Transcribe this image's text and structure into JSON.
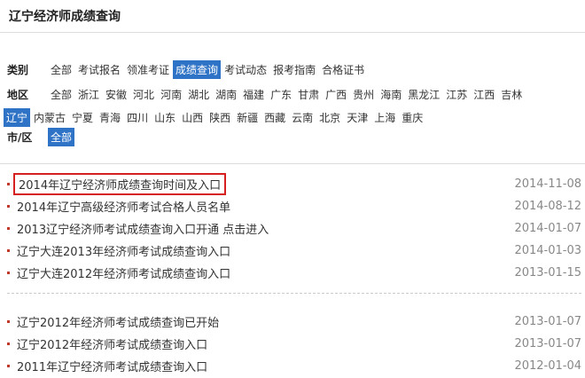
{
  "title": "辽宁经济师成绩查询",
  "filters": {
    "category": {
      "label": "类别",
      "options": [
        "全部",
        "考试报名",
        "领准考证",
        "成绩查询",
        "考试动态",
        "报考指南",
        "合格证书"
      ],
      "selected": 3
    },
    "region": {
      "label": "地区",
      "row1": [
        "全部",
        "浙江",
        "安徽",
        "河北",
        "河南",
        "湖北",
        "湖南",
        "福建",
        "广东",
        "甘肃",
        "广西",
        "贵州",
        "海南",
        "黑龙江",
        "江苏",
        "江西",
        "吉林"
      ],
      "row2": [
        "辽宁",
        "内蒙古",
        "宁夏",
        "青海",
        "四川",
        "山东",
        "山西",
        "陕西",
        "新疆",
        "西藏",
        "云南",
        "北京",
        "天津",
        "上海",
        "重庆"
      ],
      "selected_row2": 0
    },
    "city": {
      "label": "市/区",
      "options": [
        "全部"
      ],
      "selected": 0
    }
  },
  "news_group1": [
    {
      "title": "2014年辽宁经济师成绩查询时间及入口",
      "date": "2014-11-08"
    },
    {
      "title": "2014年辽宁高级经济师考试合格人员名单",
      "date": "2014-08-12"
    },
    {
      "title": "2013辽宁经济师考试成绩查询入口开通 点击进入",
      "date": "2014-01-07"
    },
    {
      "title": "辽宁大连2013年经济师考试成绩查询入口",
      "date": "2014-01-03"
    },
    {
      "title": "辽宁大连2012年经济师考试成绩查询入口",
      "date": "2013-01-15"
    }
  ],
  "news_group2": [
    {
      "title": "辽宁2012年经济师考试成绩查询已开始",
      "date": "2013-01-07"
    },
    {
      "title": "辽宁2012年经济师考试成绩查询入口",
      "date": "2013-01-07"
    },
    {
      "title": "2011年辽宁经济师考试成绩查询入口",
      "date": "2012-01-04"
    }
  ],
  "colors": {
    "accent": "#2f73c6",
    "highlight_border": "#d62020",
    "bullet": "#c0392b"
  }
}
